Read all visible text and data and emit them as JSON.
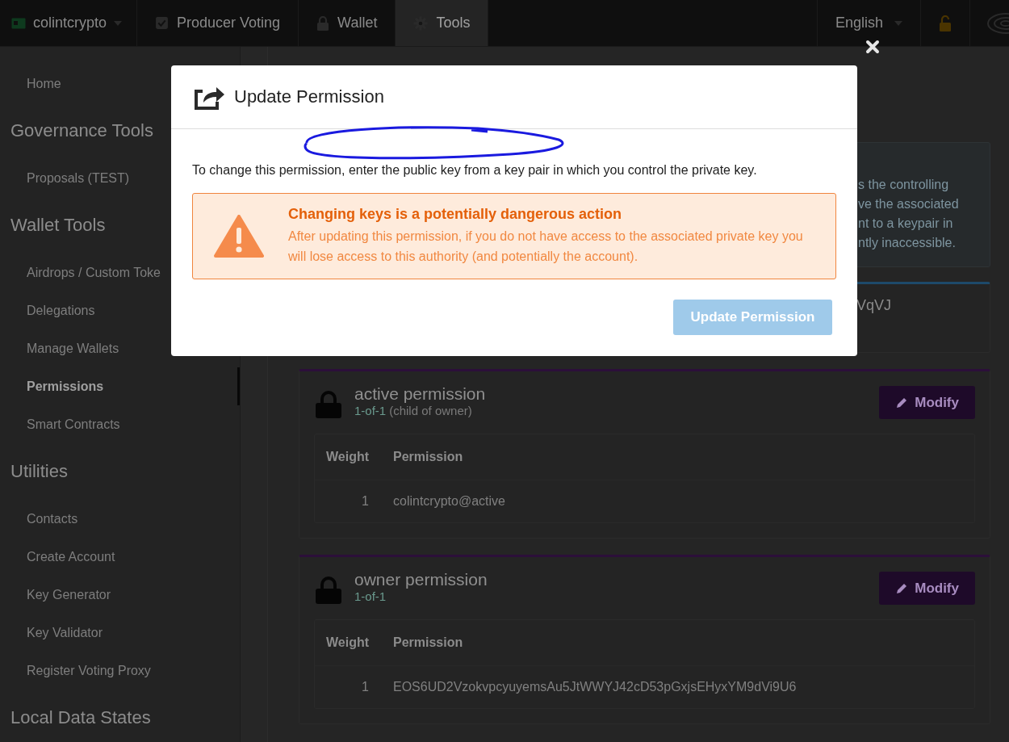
{
  "topbar": {
    "account": {
      "label": "colintcrypto"
    },
    "nav": [
      {
        "label": "Producer Voting",
        "kind": "check",
        "selected": false
      },
      {
        "label": "Wallet",
        "kind": "lock",
        "selected": false
      },
      {
        "label": "Tools",
        "kind": "gear",
        "selected": true
      }
    ],
    "language": "English"
  },
  "sidebar": {
    "sections": [
      {
        "items": [
          {
            "label": "Home",
            "selected": false
          }
        ]
      },
      {
        "heading": "Governance Tools",
        "items": [
          {
            "label": "Proposals (TEST)",
            "selected": false
          }
        ]
      },
      {
        "heading": "Wallet Tools",
        "items": [
          {
            "label": "Airdrops / Custom Toke",
            "selected": false
          },
          {
            "label": "Delegations",
            "selected": false
          },
          {
            "label": "Manage Wallets",
            "selected": false
          },
          {
            "label": "Permissions",
            "selected": true
          },
          {
            "label": "Smart Contracts",
            "selected": false
          }
        ]
      },
      {
        "heading": "Utilities",
        "items": [
          {
            "label": "Contacts",
            "selected": false
          },
          {
            "label": "Create Account",
            "selected": false
          },
          {
            "label": "Key Generator",
            "selected": false
          },
          {
            "label": "Key Validator",
            "selected": false
          },
          {
            "label": "Register Voting Proxy",
            "selected": false
          }
        ]
      },
      {
        "heading": "Local Data States"
      }
    ]
  },
  "info_box": {
    "lines": [
      "s the controlling",
      "ve the associated",
      "nt to a keypair in",
      "ntly inaccessible."
    ]
  },
  "partial_card": {
    "text": "VqVJ",
    "color": "#1d4a6a"
  },
  "permissions": [
    {
      "title": "active permission",
      "threshold": "1-of-1",
      "parent": "(child of owner)",
      "color": "#2c0f3a",
      "button": "Modify",
      "columns": [
        "Weight",
        "Permission"
      ],
      "rows": [
        {
          "weight": "1",
          "permission": "colintcrypto@active"
        }
      ]
    },
    {
      "title": "owner permission",
      "threshold": "1-of-1",
      "color": "#2c0f3a",
      "button": "Modify",
      "columns": [
        "Weight",
        "Permission"
      ],
      "rows": [
        {
          "weight": "1",
          "permission": "EOS6UD2VzokvpcyuyemsAu5JtWWYJ42cD53pGxjsEHyxYM9dVi9U6"
        }
      ]
    }
  ],
  "modal": {
    "title": "Update Permission",
    "intro": "To change this permission, enter the public key from a key pair in which you control the private key.",
    "warning": {
      "title": "Changing keys is a potentially dangerous action",
      "body": "After updating this permission, if you do not have access to the associated private key you will lose access to this authority (and potentially the account)."
    },
    "button": {
      "label": "Update Permission",
      "disabled": true
    }
  }
}
